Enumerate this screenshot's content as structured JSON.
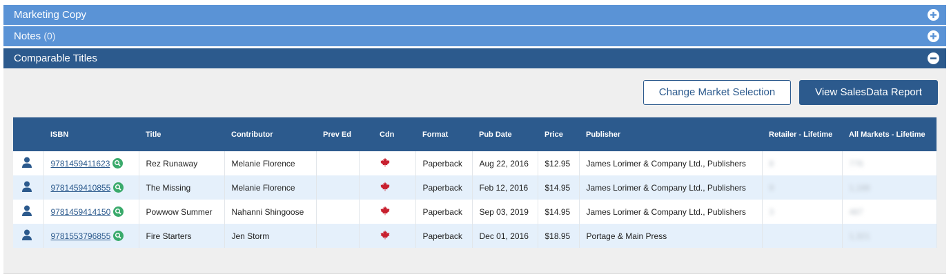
{
  "panels": {
    "marketing_copy": {
      "title": "Marketing Copy",
      "state": "collapsed"
    },
    "notes": {
      "title": "Notes",
      "count": "(0)",
      "state": "collapsed"
    },
    "comparable_titles": {
      "title": "Comparable Titles",
      "state": "expanded"
    }
  },
  "actions": {
    "change_market": "Change Market Selection",
    "view_report": "View SalesData Report"
  },
  "table": {
    "columns": [
      "",
      "ISBN",
      "Title",
      "Contributor",
      "Prev Ed",
      "Cdn",
      "Format",
      "Pub Date",
      "Price",
      "Publisher",
      "Retailer - Lifetime",
      "All Markets - Lifetime"
    ],
    "rows": [
      {
        "isbn": "9781459411623",
        "title": "Rez Runaway",
        "contributor": "Melanie Florence",
        "prev_ed": "",
        "cdn_icon": "maple-leaf-icon",
        "format": "Paperback",
        "pub_date": "Aug 22, 2016",
        "price": "$12.95",
        "publisher": "James Lorimer & Company Ltd., Publishers",
        "retailer_lifetime": "8",
        "all_markets_lifetime": "776"
      },
      {
        "isbn": "9781459410855",
        "title": "The Missing",
        "contributor": "Melanie Florence",
        "prev_ed": "",
        "cdn_icon": "maple-leaf-icon",
        "format": "Paperback",
        "pub_date": "Feb 12, 2016",
        "price": "$14.95",
        "publisher": "James Lorimer & Company Ltd., Publishers",
        "retailer_lifetime": "9",
        "all_markets_lifetime": "1,188"
      },
      {
        "isbn": "9781459414150",
        "title": "Powwow Summer",
        "contributor": "Nahanni Shingoose",
        "prev_ed": "",
        "cdn_icon": "maple-leaf-icon",
        "format": "Paperback",
        "pub_date": "Sep 03, 2019",
        "price": "$14.95",
        "publisher": "James Lorimer & Company Ltd., Publishers",
        "retailer_lifetime": "3",
        "all_markets_lifetime": "487"
      },
      {
        "isbn": "9781553796855",
        "title": "Fire Starters",
        "contributor": "Jen Storm",
        "prev_ed": "",
        "cdn_icon": "maple-leaf-icon",
        "format": "Paperback",
        "pub_date": "Dec 01, 2016",
        "price": "$18.95",
        "publisher": "Portage & Main Press",
        "retailer_lifetime": "",
        "all_markets_lifetime": "1,321"
      }
    ]
  },
  "colors": {
    "bar_light": "#5a93d6",
    "bar_dark": "#2c5a8d",
    "row_alt": "#e5f0fb",
    "maple_red": "#c8202f",
    "search_green": "#3aaa6b"
  }
}
